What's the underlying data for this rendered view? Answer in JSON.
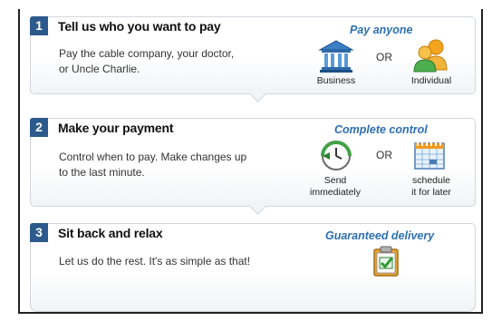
{
  "steps": [
    {
      "number": "1",
      "title": "Tell us who you want to pay",
      "description": [
        "Pay the cable company, your doctor,",
        "or Uncle Charlie."
      ],
      "tagline": "Pay anyone",
      "options": [
        {
          "icon": "bank-building-icon",
          "label": [
            "Business"
          ]
        },
        {
          "icon": "people-icon",
          "label": [
            "Individual"
          ]
        }
      ],
      "or_label": "OR"
    },
    {
      "number": "2",
      "title": "Make your payment",
      "description": [
        "Control when to pay. Make changes up",
        "to the last minute."
      ],
      "tagline": "Complete control",
      "options": [
        {
          "icon": "clock-arrow-icon",
          "label": [
            "Send",
            "immediately"
          ]
        },
        {
          "icon": "calendar-icon",
          "label": [
            "schedule",
            "it for later"
          ]
        }
      ],
      "or_label": "OR"
    },
    {
      "number": "3",
      "title": "Sit back and relax",
      "description": [
        "Let us do the rest. It's as simple as that!"
      ],
      "tagline": "Guaranteed delivery",
      "options": [
        {
          "icon": "clipboard-check-icon",
          "label": []
        }
      ]
    }
  ],
  "colors": {
    "badge": "#2d5a8c",
    "tagline": "#2d6fb3",
    "border": "#d2d6dc"
  }
}
